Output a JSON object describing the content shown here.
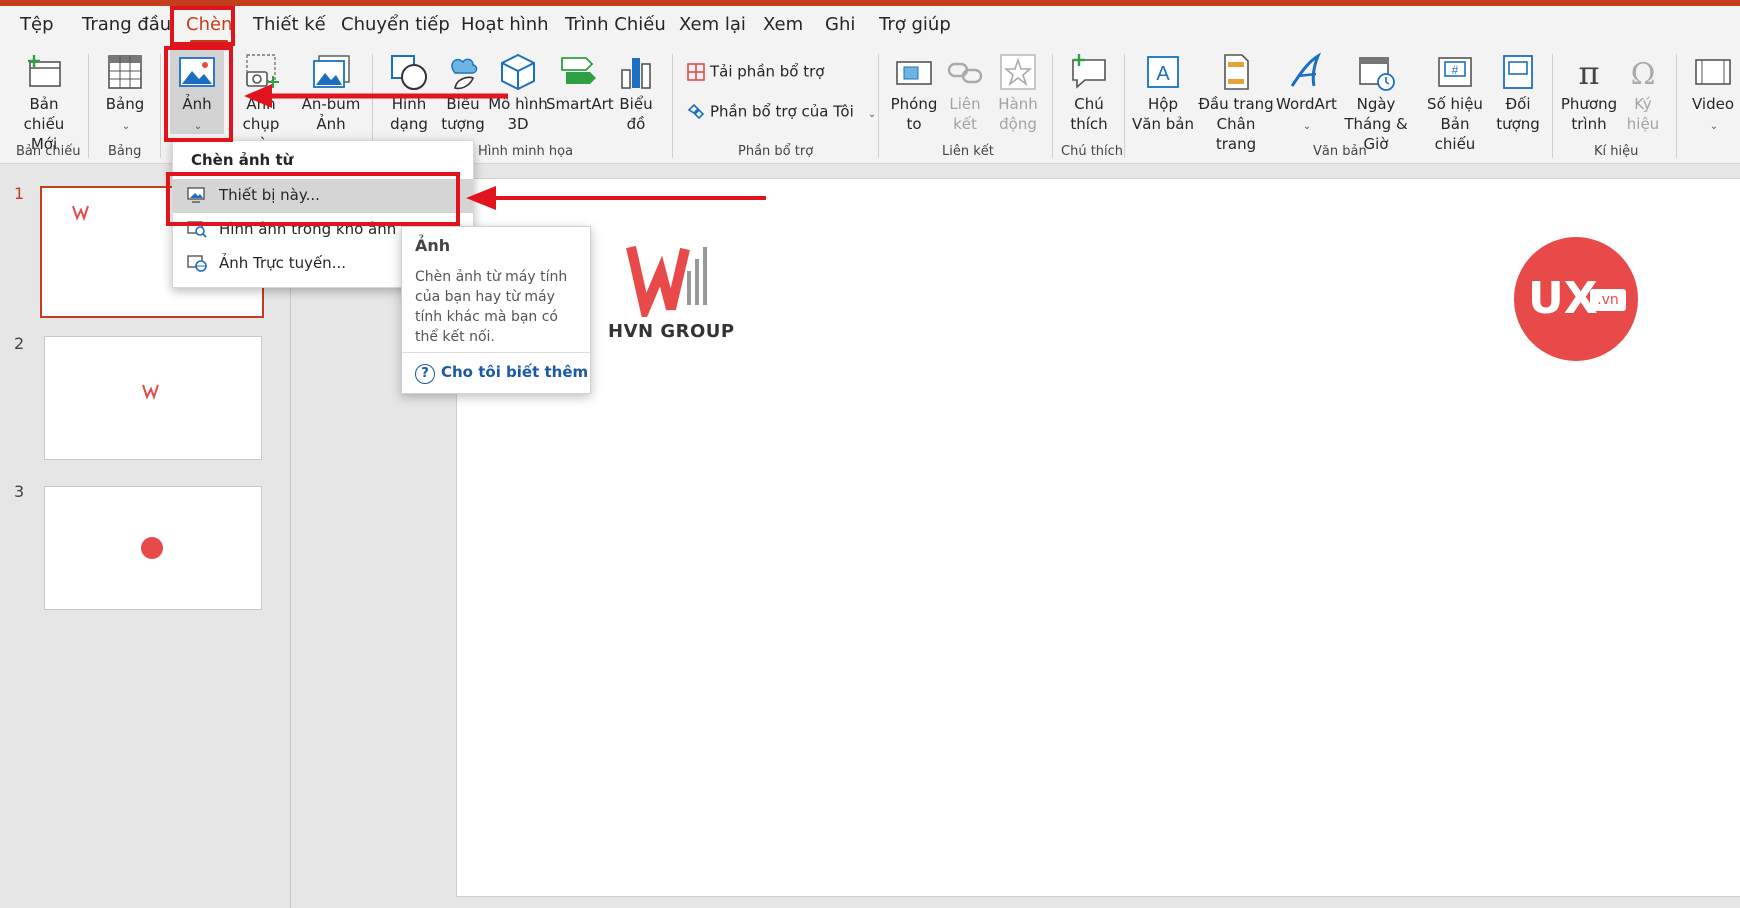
{
  "menu": {
    "tabs": [
      "Tệp",
      "Trang đầu",
      "Chèn",
      "Thiết kế",
      "Chuyển tiếp",
      "Hoạt hình",
      "Trình Chiếu",
      "Xem lại",
      "Xem",
      "Ghi",
      "Trợ giúp"
    ],
    "active_tab": "Chèn"
  },
  "ribbon": {
    "new_slide": "Bản chiếu Mới",
    "table": "Bảng",
    "pictures": "Ảnh",
    "screenshot": "Ảnh chụp màn hình",
    "album": "An-bum Ảnh",
    "shapes": "Hình dạng",
    "icons": "Biểu tượng",
    "models3d": "Mô hình 3D",
    "smartart": "SmartArt",
    "chart": "Biểu đồ",
    "get_addins": "Tải phần bổ trợ",
    "my_addins": "Phần bổ trợ của Tôi",
    "zoom": "Phóng to",
    "link": "Liên kết",
    "action": "Hành động",
    "comment": "Chú thích",
    "textbox": "Hộp Văn bản",
    "header_footer": "Đầu trang Chân trang",
    "wordart": "WordArt",
    "date_time": "Ngày Tháng & Giờ",
    "slide_number": "Số hiệu Bản chiếu",
    "object": "Đối tượng",
    "equation": "Phương trình",
    "symbol": "Ký hiệu",
    "video": "Video",
    "groups": {
      "slides": "Bản chiếu",
      "tables": "Bảng",
      "illustrations": "Hình minh họa",
      "addins": "Phần bổ trợ",
      "links": "Liên kết",
      "comments": "Chú thích",
      "text": "Văn bản",
      "symbols": "Kí hiệu"
    }
  },
  "dropdown": {
    "header": "Chèn ảnh từ",
    "items": [
      "Thiết bị này...",
      "Hình ảnh trong kho ảnh dự trữ...",
      "Ảnh Trực tuyến..."
    ]
  },
  "tooltip": {
    "title": "Ảnh",
    "description": "Chèn ảnh từ máy tính của bạn hay từ máy tính khác mà bạn có thể kết nối.",
    "learn_more": "Cho tôi biết thêm"
  },
  "slides": {
    "numbers": [
      "1",
      "2",
      "3"
    ],
    "active": 1
  },
  "slide_content": {
    "logo_text": "HVN GROUP",
    "ux_logo_main": "UX",
    "ux_logo_suffix": ".vn"
  },
  "colors": {
    "accent": "#c43e1c",
    "highlight_red": "#e0141c",
    "logo_red": "#e84a4a",
    "link_blue": "#1b5aa6"
  }
}
